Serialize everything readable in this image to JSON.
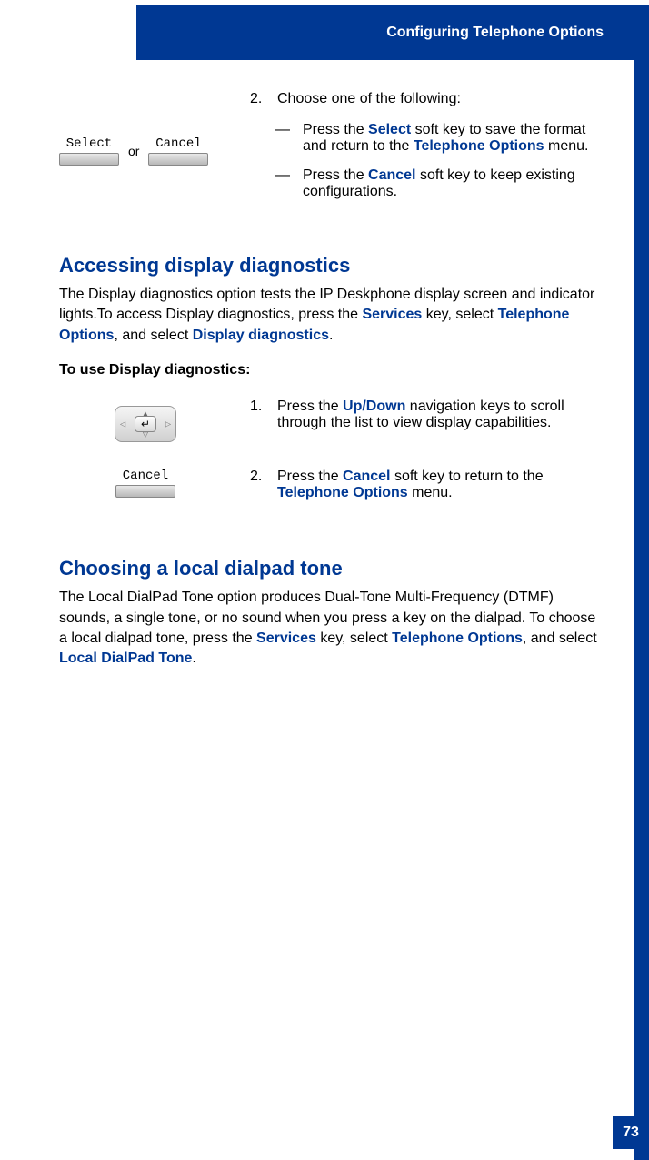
{
  "header": {
    "title": "Configuring Telephone Options"
  },
  "page_number": "73",
  "top_step": {
    "num": "2.",
    "intro": "Choose one of the following:",
    "sub1_pre": "Press the ",
    "sub1_hl1": "Select",
    "sub1_mid": " soft key to save the format and return to the ",
    "sub1_hl2": "Telephone Options",
    "sub1_end": " menu.",
    "sub2_pre": "Press the ",
    "sub2_hl1": "Cancel",
    "sub2_end": " soft key to keep existing configurations."
  },
  "softkeys": {
    "select": "Select",
    "cancel": "Cancel",
    "or": "or"
  },
  "section1": {
    "heading": "Accessing display diagnostics",
    "body_pre": "The Display diagnostics option tests the IP Deskphone display screen and indicator lights.To access Display diagnostics, press the ",
    "body_hl1": "Services",
    "body_mid1": " key, select ",
    "body_hl2": "Telephone Options",
    "body_mid2": ", and select ",
    "body_hl3": "Display diagnostics",
    "body_end": ".",
    "subhead": "To use Display diagnostics:",
    "step1_num": "1.",
    "step1_pre": "Press the ",
    "step1_hl1": "Up/Down",
    "step1_end": " navigation keys to scroll through the list to view display capabilities.",
    "step2_num": "2.",
    "step2_pre": "Press the ",
    "step2_hl1": "Cancel",
    "step2_mid": " soft key to return to the ",
    "step2_hl2": "Telephone Options",
    "step2_end": " menu.",
    "cancel_key": "Cancel"
  },
  "section2": {
    "heading": "Choosing a local dialpad tone",
    "body_pre": "The Local DialPad Tone option produces Dual-Tone Multi-Frequency (DTMF) sounds, a single tone, or no sound when you press a key on the dialpad. To choose a local dialpad tone, press the ",
    "body_hl1": "Services",
    "body_mid1": " key, select ",
    "body_hl2": "Telephone Options",
    "body_mid2": ", and select ",
    "body_hl3": "Local DialPad Tone",
    "body_end": "."
  }
}
